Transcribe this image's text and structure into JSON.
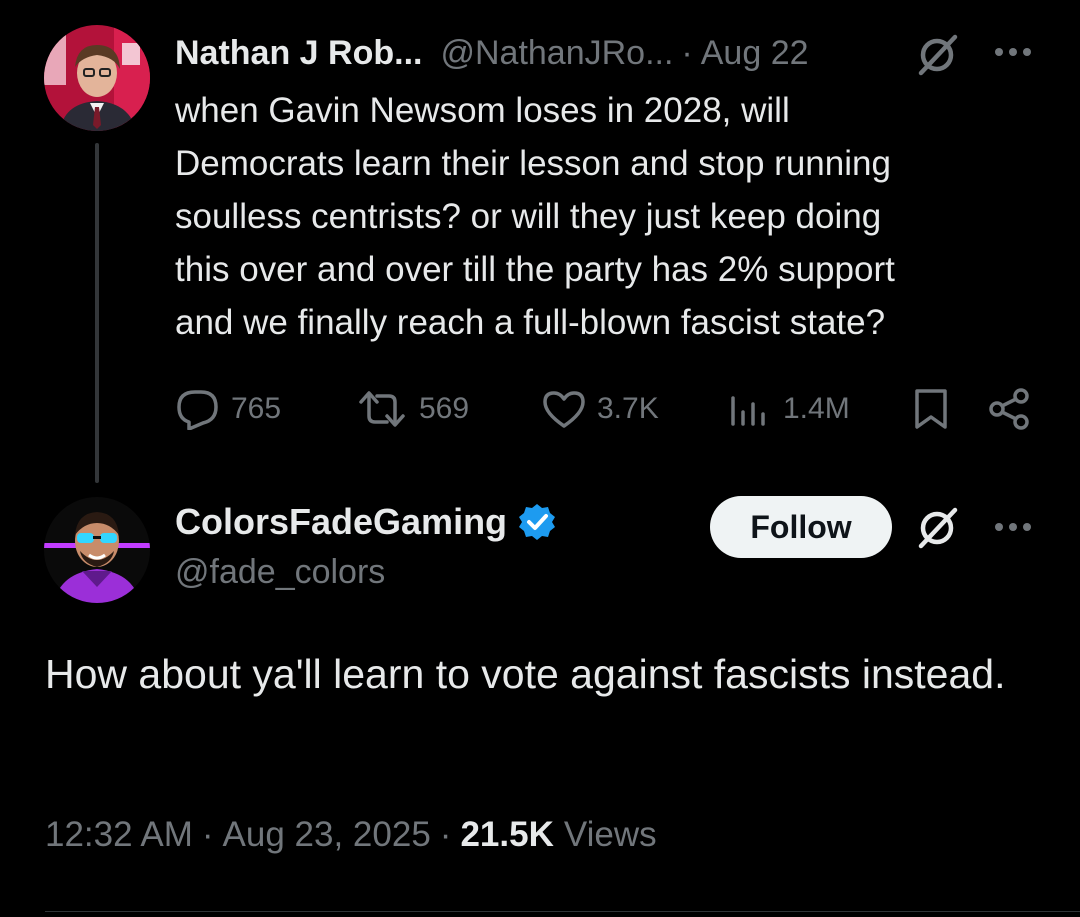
{
  "quoted_tweet": {
    "author_name": "Nathan J Rob...",
    "handle": "@NathanJRo...",
    "separator": "·",
    "date": "Aug 22",
    "text": "when Gavin Newsom loses in 2028, will\nDemocrats learn their lesson and stop running\nsoulless centrists? or will they just keep doing\nthis over and over till the party has 2% support\nand we finally reach a full-blown fascist state?",
    "replies": "765",
    "reposts": "569",
    "likes": "3.7K",
    "views": "1.4M",
    "icons": [
      "grok-icon",
      "more-icon",
      "reply-icon",
      "repost-icon",
      "like-icon",
      "views-icon",
      "bookmark-icon",
      "share-icon"
    ]
  },
  "main_tweet": {
    "author_name": "ColorsFadeGaming",
    "handle": "@fade_colors",
    "follow_label": "Follow",
    "text": "How about ya'll learn to vote against fascists instead.",
    "time": "12:32 AM",
    "separator": "·",
    "date": "Aug 23, 2025",
    "views_count": "21.5K",
    "views_label": "Views",
    "verified_color": "#1d9bf0"
  },
  "colors": {
    "background": "#000000",
    "text_primary": "#e7e9ea",
    "text_secondary": "#71767b",
    "follow_bg": "#eff3f4"
  }
}
